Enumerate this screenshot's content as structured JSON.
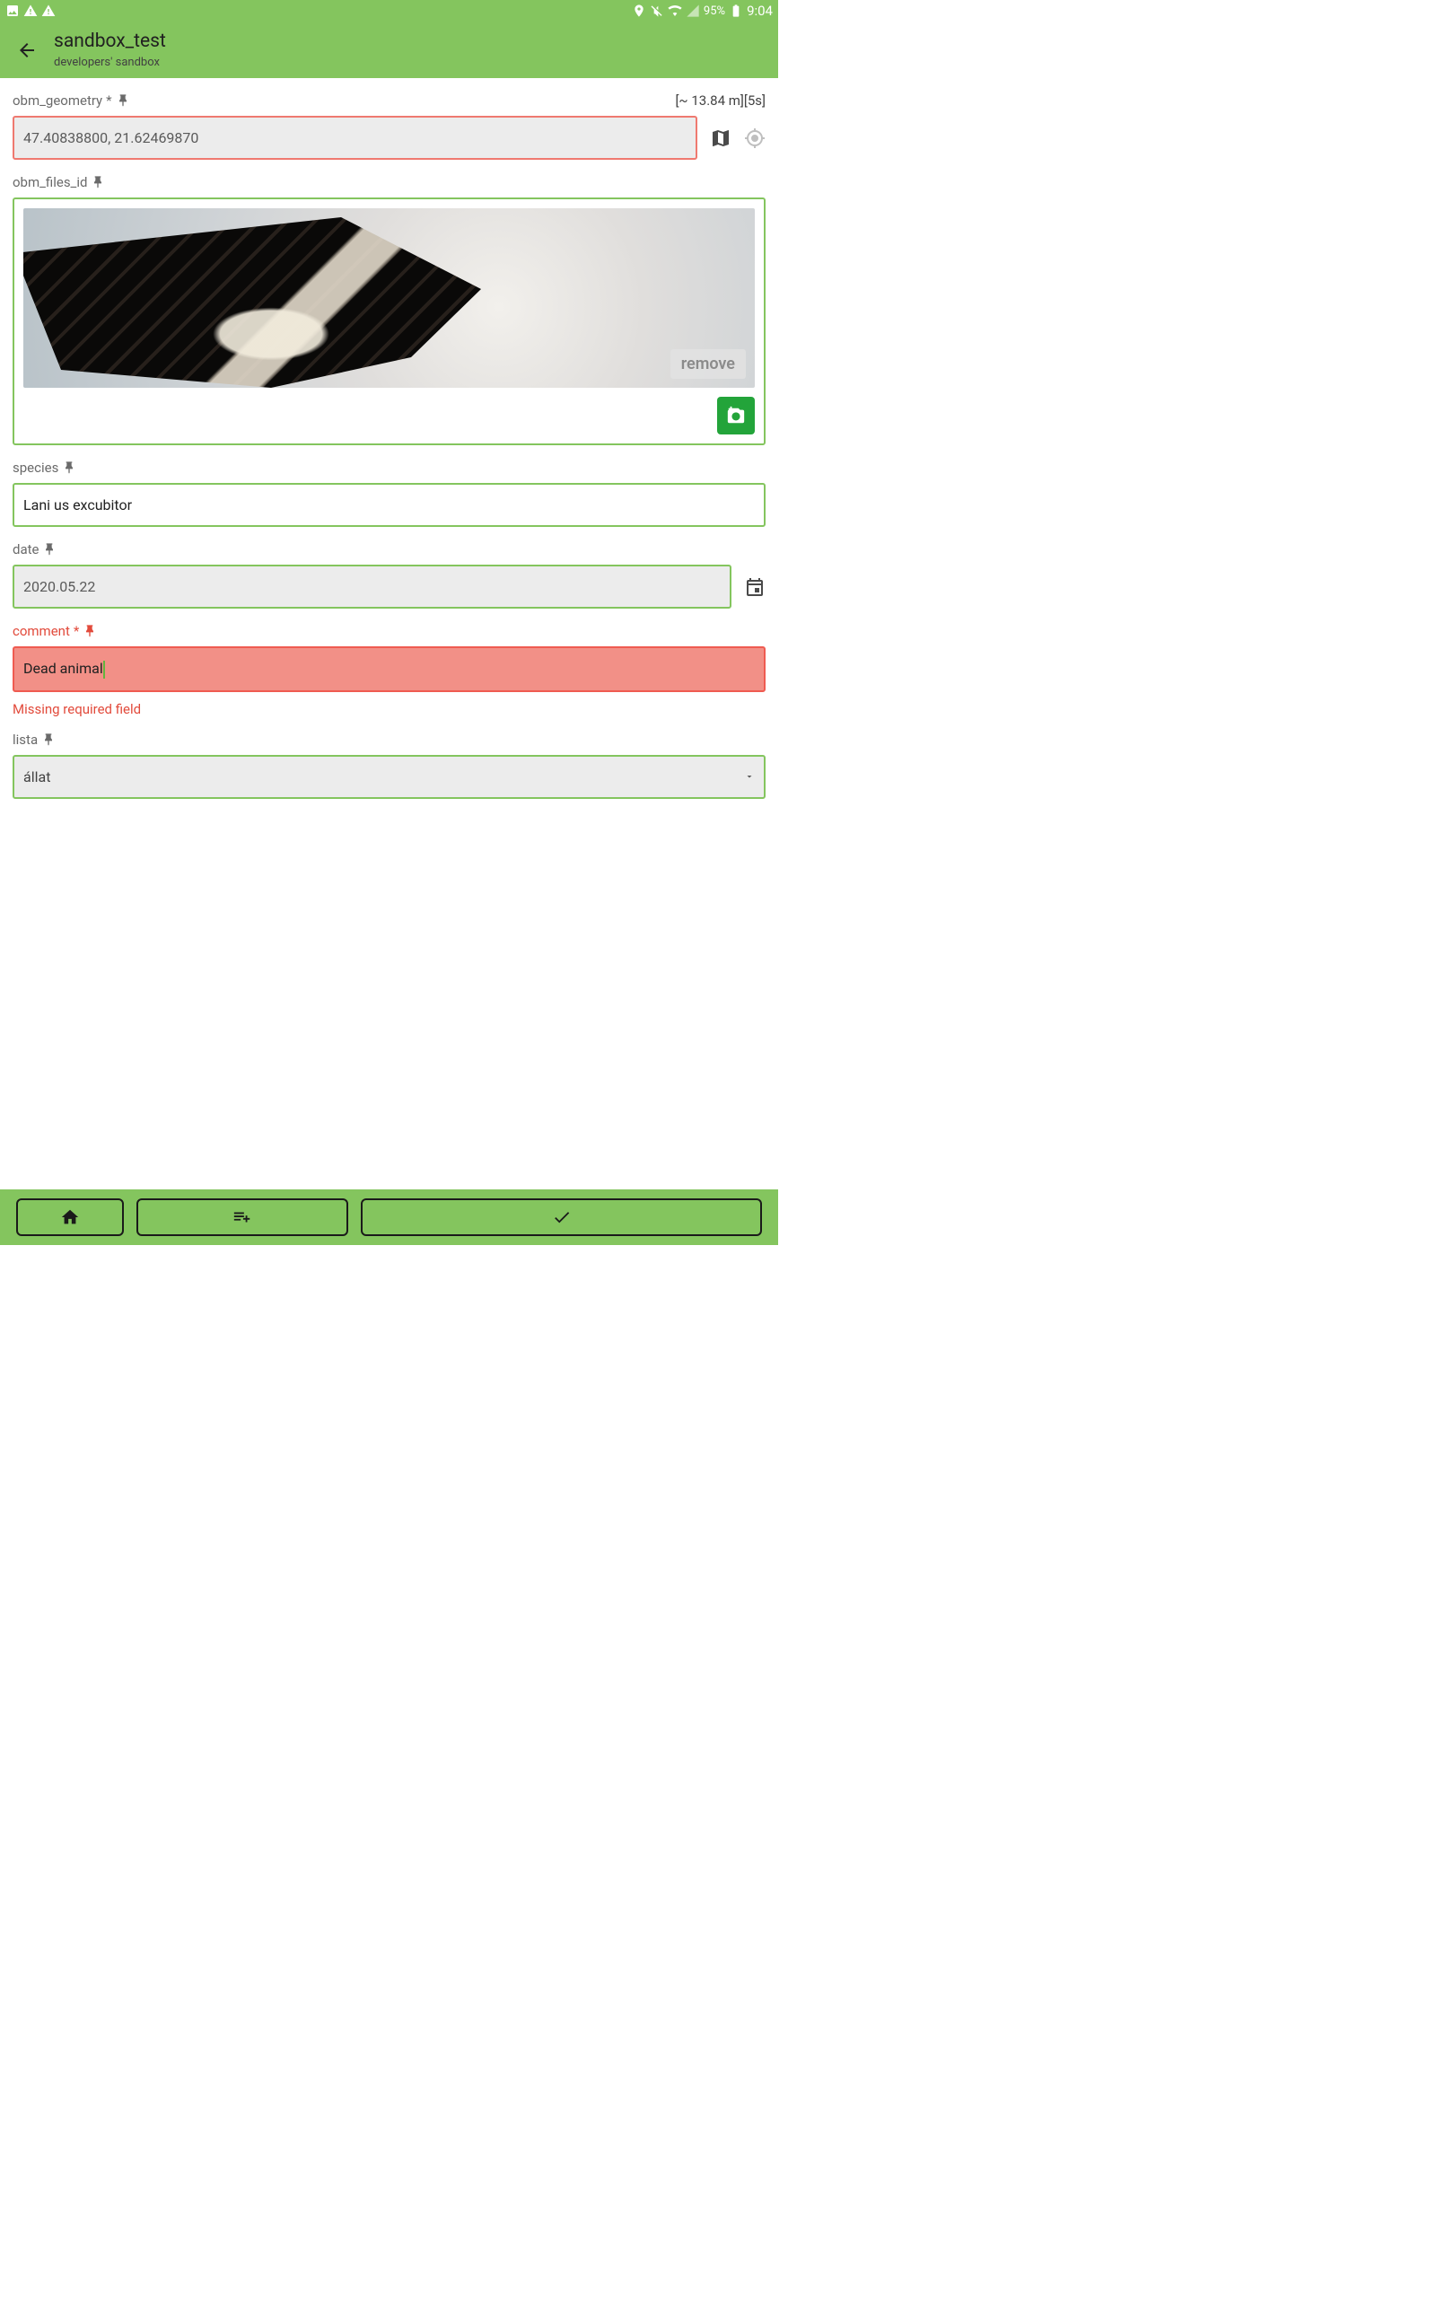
{
  "status": {
    "battery_pct": "95%",
    "clock": "9:04"
  },
  "header": {
    "title": "sandbox_test",
    "subtitle": "developers' sandbox"
  },
  "accuracy_text": "[~ 13.84 m][5s]",
  "geometry": {
    "label": "obm_geometry",
    "value": "47.40838800, 21.62469870"
  },
  "files": {
    "label": "obm_files_id",
    "remove_label": "remove"
  },
  "species": {
    "label": "species",
    "value": "Lani us excubitor"
  },
  "date": {
    "label": "date",
    "value": "2020.05.22"
  },
  "comment": {
    "label": "comment",
    "value": "Dead animal",
    "error": "Missing required field"
  },
  "lista": {
    "label": "lista",
    "selected": "állat"
  }
}
